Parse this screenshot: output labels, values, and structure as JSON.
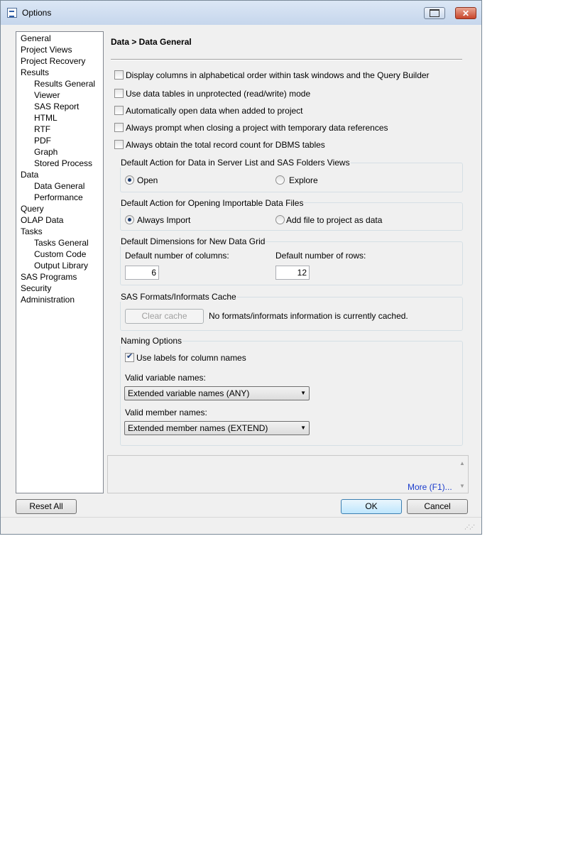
{
  "window": {
    "title": "Options"
  },
  "nav": {
    "items": [
      {
        "label": "General",
        "level": 0
      },
      {
        "label": "Project Views",
        "level": 0
      },
      {
        "label": "Project Recovery",
        "level": 0
      },
      {
        "label": "Results",
        "level": 0
      },
      {
        "label": "Results General",
        "level": 1
      },
      {
        "label": "Viewer",
        "level": 1
      },
      {
        "label": "SAS Report",
        "level": 1
      },
      {
        "label": "HTML",
        "level": 1
      },
      {
        "label": "RTF",
        "level": 1
      },
      {
        "label": "PDF",
        "level": 1
      },
      {
        "label": "Graph",
        "level": 1
      },
      {
        "label": "Stored Process",
        "level": 1
      },
      {
        "label": "Data",
        "level": 0
      },
      {
        "label": "Data General",
        "level": 1
      },
      {
        "label": "Performance",
        "level": 1
      },
      {
        "label": "Query",
        "level": 0
      },
      {
        "label": "OLAP Data",
        "level": 0
      },
      {
        "label": "Tasks",
        "level": 0
      },
      {
        "label": "Tasks General",
        "level": 1
      },
      {
        "label": "Custom Code",
        "level": 1
      },
      {
        "label": "Output Library",
        "level": 1
      },
      {
        "label": "SAS Programs",
        "level": 0
      },
      {
        "label": "Security",
        "level": 0
      },
      {
        "label": "Administration",
        "level": 0
      }
    ]
  },
  "panel": {
    "heading": "Data > Data General",
    "checkboxes": [
      {
        "label": "Display columns in alphabetical order within task windows and the Query Builder",
        "checked": false
      },
      {
        "label": "Use data tables in unprotected (read/write) mode",
        "checked": false
      },
      {
        "label": "Automatically open data when added to project",
        "checked": false
      },
      {
        "label": "Always prompt when closing a project with temporary data references",
        "checked": false
      },
      {
        "label": "Always obtain the total record count for DBMS tables",
        "checked": false
      }
    ],
    "default_action": {
      "title": "Default Action for Data in Server List and SAS Folders Views",
      "open_label": "Open",
      "explore_label": "Explore",
      "selected": "Open"
    },
    "import_action": {
      "title": "Default Action for Opening Importable Data Files",
      "import_label": "Always Import",
      "add_label": "Add file to project as data",
      "selected": "Always Import"
    },
    "grid": {
      "title": "Default Dimensions for New Data Grid",
      "columns_label": "Default number of columns:",
      "columns_value": "6",
      "rows_label": "Default number of rows:",
      "rows_value": "12"
    },
    "cache": {
      "title": "SAS Formats/Informats Cache",
      "clear_label": "Clear cache",
      "status": "No formats/informats information is currently cached."
    },
    "naming": {
      "title": "Naming Options",
      "use_labels": "Use labels for column names",
      "use_labels_checked": true,
      "variable_label": "Valid variable names:",
      "variable_value": "Extended variable names (ANY)",
      "member_label": "Valid member names:",
      "member_value": "Extended member names (EXTEND)"
    }
  },
  "help": {
    "more_link": "More (F1)..."
  },
  "footer": {
    "reset_label": "Reset All",
    "ok_label": "OK",
    "cancel_label": "Cancel"
  }
}
